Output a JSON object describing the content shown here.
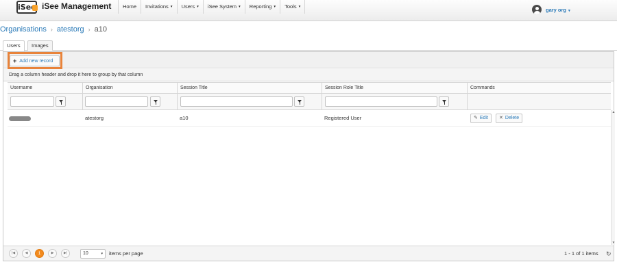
{
  "app": {
    "logo_text": "iSee",
    "brand": "iSee Management",
    "nav": [
      {
        "label": "Home"
      },
      {
        "label": "Invitations"
      },
      {
        "label": "Users"
      },
      {
        "label": "iSee System"
      },
      {
        "label": "Reporting"
      },
      {
        "label": "Tools"
      }
    ],
    "user_name": "gary org",
    "caret": "▾"
  },
  "breadcrumb": {
    "items": [
      "Organisations",
      "atestorg"
    ],
    "current": "a10",
    "separator": "›"
  },
  "tabs": [
    {
      "label": "Users",
      "active": true
    },
    {
      "label": "Images",
      "active": false
    }
  ],
  "grid": {
    "add_button_label": "Add new record",
    "group_hint": "Drag a column header and drop it here to group by that column",
    "columns": [
      "Username",
      "Organisation",
      "Session Title",
      "Session Role Title",
      "Commands"
    ],
    "rows": [
      {
        "username": "",
        "organisation": "atestorg",
        "session_title": "a10",
        "session_role_title": "Registered User"
      }
    ],
    "edit_label": "Edit",
    "delete_label": "Delete"
  },
  "pager": {
    "current_page": "1",
    "page_size": "10",
    "per_page_label": "items per page",
    "range_label": "1 - 1 of 1 items"
  },
  "colors": {
    "link": "#2a7ab8",
    "highlight": "#e8833a",
    "current_page": "#f28a1e"
  },
  "icons": [
    "plus-icon",
    "filter-icon",
    "edit-icon",
    "delete-icon",
    "refresh-icon",
    "avatar-icon"
  ]
}
